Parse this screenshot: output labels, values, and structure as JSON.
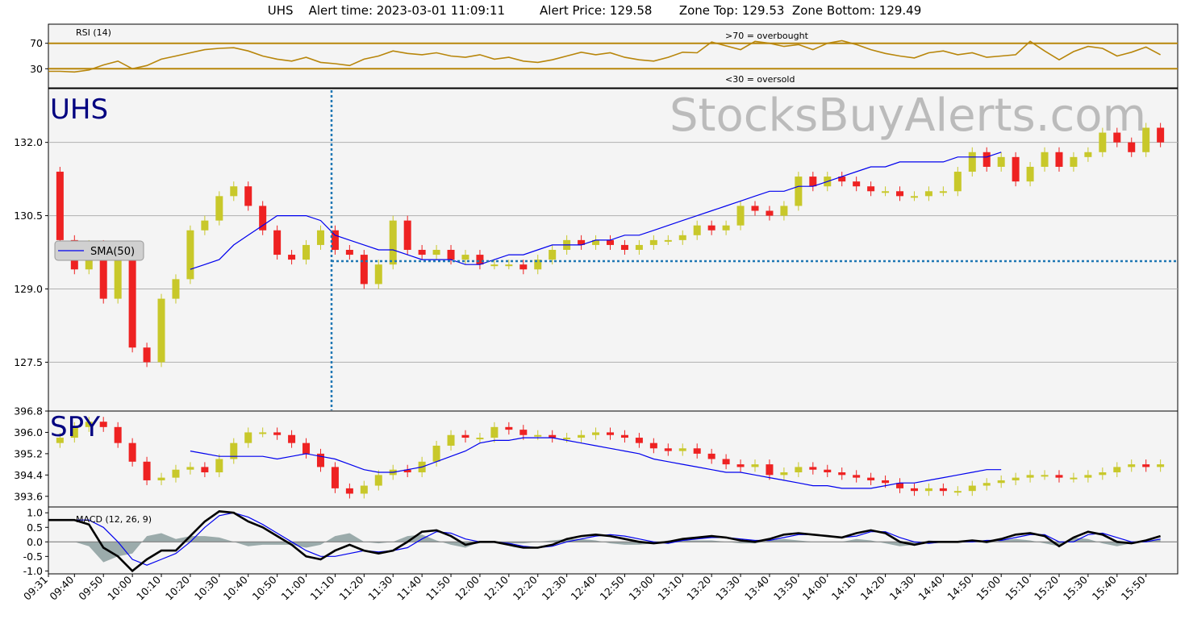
{
  "header": {
    "symbol": "UHS",
    "alert_time_label": "Alert time:",
    "alert_time": "2023-03-01 11:09:11",
    "alert_price_label": "Alert Price:",
    "alert_price": "129.58",
    "zone_top_label": "Zone Top:",
    "zone_top": "129.53",
    "zone_bottom_label": "Zone Bottom:",
    "zone_bottom": "129.49"
  },
  "watermark": "StocksBuyAlerts.com",
  "colors": {
    "panel_bg": "#f4f4f4",
    "rsi_line": "#b8860b",
    "candle_up": "#c8c82a",
    "candle_down": "#ee2222",
    "sma": "#0000ee",
    "volume": "#add8e6",
    "macd_line": "#000000",
    "signal_line": "#0000ee",
    "histogram": "#5f7a7a",
    "alert_marker": "#1f77b4",
    "symbol_label": "#000080",
    "watermark": "#bbbbbb"
  },
  "time_axis": {
    "labels": [
      "09:31",
      "09:40",
      "09:50",
      "10:00",
      "10:10",
      "10:20",
      "10:30",
      "10:40",
      "10:50",
      "11:00",
      "11:10",
      "11:20",
      "11:30",
      "11:40",
      "11:50",
      "12:00",
      "12:10",
      "12:20",
      "12:30",
      "12:40",
      "12:50",
      "13:00",
      "13:10",
      "13:20",
      "13:30",
      "13:40",
      "13:50",
      "14:00",
      "14:10",
      "14:20",
      "14:30",
      "14:40",
      "14:50",
      "15:00",
      "15:10",
      "15:20",
      "15:30",
      "15:40",
      "15:50"
    ]
  },
  "chart_data": [
    {
      "type": "line",
      "panel": "rsi",
      "title": "RSI (14)",
      "ylim": [
        0,
        100
      ],
      "yticks": [
        30,
        70
      ],
      "overbought_label": ">70 = overbought",
      "oversold_label": "<30 = oversold",
      "x": [
        "09:31",
        "09:35",
        "09:40",
        "09:45",
        "09:50",
        "09:55",
        "10:00",
        "10:05",
        "10:10",
        "10:15",
        "10:20",
        "10:25",
        "10:30",
        "10:35",
        "10:40",
        "10:45",
        "10:50",
        "10:55",
        "11:00",
        "11:05",
        "11:10",
        "11:15",
        "11:20",
        "11:25",
        "11:30",
        "11:35",
        "11:40",
        "11:45",
        "11:50",
        "11:55",
        "12:00",
        "12:05",
        "12:10",
        "12:15",
        "12:20",
        "12:25",
        "12:30",
        "12:35",
        "12:40",
        "12:45",
        "12:50",
        "12:55",
        "13:00",
        "13:05",
        "13:10",
        "13:15",
        "13:20",
        "13:25",
        "13:30",
        "13:35",
        "13:40",
        "13:45",
        "13:50",
        "13:55",
        "14:00",
        "14:05",
        "14:10",
        "14:15",
        "14:20",
        "14:25",
        "14:30",
        "14:35",
        "14:40",
        "14:45",
        "14:50",
        "14:55",
        "15:00",
        "15:05",
        "15:10",
        "15:15",
        "15:20",
        "15:25",
        "15:30",
        "15:35",
        "15:40",
        "15:45",
        "15:50",
        "15:55"
      ],
      "series": [
        {
          "values": [
            26,
            26,
            25,
            28,
            36,
            42,
            30,
            35,
            45,
            50,
            55,
            60,
            62,
            63,
            58,
            50,
            45,
            42,
            48,
            40,
            38,
            35,
            45,
            50,
            58,
            54,
            52,
            55,
            50,
            48,
            52,
            45,
            48,
            42,
            40,
            44,
            50,
            56,
            52,
            55,
            48,
            44,
            42,
            48,
            56,
            55,
            72,
            66,
            60,
            73,
            70,
            65,
            68,
            60,
            70,
            74,
            68,
            60,
            54,
            50,
            47,
            55,
            58,
            52,
            55,
            48,
            50,
            52,
            73,
            58,
            44,
            57,
            65,
            62,
            50,
            56,
            64,
            52
          ]
        }
      ]
    },
    {
      "type": "candlestick",
      "panel": "price",
      "title": "UHS",
      "ylim": [
        126.5,
        133.1
      ],
      "yticks": [
        127.5,
        129.0,
        130.5,
        132.0
      ],
      "legend": "SMA(50)",
      "x": [
        "09:31",
        "09:35",
        "09:40",
        "09:45",
        "09:50",
        "09:55",
        "10:00",
        "10:05",
        "10:10",
        "10:15",
        "10:20",
        "10:25",
        "10:30",
        "10:35",
        "10:40",
        "10:45",
        "10:50",
        "10:55",
        "11:00",
        "11:05",
        "11:10",
        "11:15",
        "11:20",
        "11:25",
        "11:30",
        "11:35",
        "11:40",
        "11:45",
        "11:50",
        "11:55",
        "12:00",
        "12:05",
        "12:10",
        "12:15",
        "12:20",
        "12:25",
        "12:30",
        "12:35",
        "12:40",
        "12:45",
        "12:50",
        "12:55",
        "13:00",
        "13:05",
        "13:10",
        "13:15",
        "13:20",
        "13:25",
        "13:30",
        "13:35",
        "13:40",
        "13:45",
        "13:50",
        "13:55",
        "14:00",
        "14:05",
        "14:10",
        "14:15",
        "14:20",
        "14:25",
        "14:30",
        "14:35",
        "14:40",
        "14:45",
        "14:50",
        "14:55",
        "15:00",
        "15:05",
        "15:10",
        "15:15",
        "15:20",
        "15:25",
        "15:30",
        "15:35",
        "15:40",
        "15:45",
        "15:50",
        "15:55"
      ],
      "close": [
        131.4,
        130.0,
        129.4,
        129.9,
        128.8,
        129.6,
        127.8,
        127.5,
        128.8,
        129.2,
        130.2,
        130.4,
        130.9,
        131.1,
        130.7,
        130.2,
        129.7,
        129.6,
        129.9,
        130.2,
        129.8,
        129.7,
        129.1,
        129.5,
        130.4,
        129.8,
        129.7,
        129.8,
        129.6,
        129.7,
        129.5,
        129.5,
        129.5,
        129.4,
        129.6,
        129.8,
        130.0,
        129.9,
        130.0,
        129.9,
        129.8,
        129.9,
        130.0,
        130.0,
        130.1,
        130.3,
        130.2,
        130.3,
        130.7,
        130.6,
        130.5,
        130.7,
        131.3,
        131.1,
        131.3,
        131.2,
        131.1,
        131.0,
        131.0,
        130.9,
        130.9,
        131.0,
        131.0,
        131.4,
        131.8,
        131.5,
        131.7,
        131.2,
        131.5,
        131.8,
        131.5,
        131.7,
        131.8,
        132.2,
        132.0,
        131.8,
        132.3,
        132.0
      ],
      "sma50": [
        null,
        null,
        null,
        null,
        null,
        null,
        null,
        null,
        null,
        null,
        129.4,
        129.5,
        129.6,
        129.9,
        130.1,
        130.3,
        130.5,
        130.5,
        130.5,
        130.4,
        130.1,
        130.0,
        129.9,
        129.8,
        129.8,
        129.7,
        129.6,
        129.6,
        129.6,
        129.5,
        129.5,
        129.6,
        129.7,
        129.7,
        129.8,
        129.9,
        129.9,
        129.9,
        130.0,
        130.0,
        130.1,
        130.1,
        130.2,
        130.3,
        130.4,
        130.5,
        130.6,
        130.7,
        130.8,
        130.9,
        131.0,
        131.0,
        131.1,
        131.1,
        131.2,
        131.3,
        131.4,
        131.5,
        131.5,
        131.6,
        131.6,
        131.6,
        131.6,
        131.7,
        131.7,
        131.7,
        131.8
      ]
    },
    {
      "type": "candlestick",
      "panel": "spy",
      "title": "SPY",
      "ylim": [
        393.2,
        396.8
      ],
      "yticks": [
        393.6,
        394.4,
        395.2,
        396.0,
        396.8
      ],
      "x": [
        "09:31",
        "09:35",
        "09:40",
        "09:45",
        "09:50",
        "09:55",
        "10:00",
        "10:05",
        "10:10",
        "10:15",
        "10:20",
        "10:25",
        "10:30",
        "10:35",
        "10:40",
        "10:45",
        "10:50",
        "10:55",
        "11:00",
        "11:05",
        "11:10",
        "11:15",
        "11:20",
        "11:25",
        "11:30",
        "11:35",
        "11:40",
        "11:45",
        "11:50",
        "11:55",
        "12:00",
        "12:05",
        "12:10",
        "12:15",
        "12:20",
        "12:25",
        "12:30",
        "12:35",
        "12:40",
        "12:45",
        "12:50",
        "12:55",
        "13:00",
        "13:05",
        "13:10",
        "13:15",
        "13:20",
        "13:25",
        "13:30",
        "13:35",
        "13:40",
        "13:45",
        "13:50",
        "13:55",
        "14:00",
        "14:05",
        "14:10",
        "14:15",
        "14:20",
        "14:25",
        "14:30",
        "14:35",
        "14:40",
        "14:45",
        "14:50",
        "14:55",
        "15:00",
        "15:05",
        "15:10",
        "15:15",
        "15:20",
        "15:25",
        "15:30",
        "15:35",
        "15:40",
        "15:45",
        "15:50",
        "15:55"
      ],
      "close": [
        395.6,
        395.8,
        396.2,
        396.4,
        396.2,
        395.6,
        394.9,
        394.2,
        394.3,
        394.6,
        394.7,
        394.5,
        395.0,
        395.6,
        396.0,
        396.0,
        395.9,
        395.6,
        395.2,
        394.7,
        393.9,
        393.7,
        394.0,
        394.4,
        394.6,
        394.5,
        394.9,
        395.5,
        395.9,
        395.8,
        395.8,
        396.2,
        396.1,
        395.9,
        395.9,
        395.8,
        395.8,
        395.9,
        396.0,
        395.9,
        395.8,
        395.6,
        395.4,
        395.3,
        395.4,
        395.2,
        395.0,
        394.8,
        394.7,
        394.8,
        394.4,
        394.5,
        394.7,
        394.6,
        394.5,
        394.4,
        394.3,
        394.2,
        394.1,
        393.9,
        393.8,
        393.9,
        393.8,
        393.8,
        394.0,
        394.1,
        394.2,
        394.3,
        394.4,
        394.4,
        394.3,
        394.3,
        394.4,
        394.5,
        394.7,
        394.8,
        394.7,
        394.8
      ],
      "sma50": [
        null,
        null,
        null,
        null,
        null,
        null,
        null,
        null,
        null,
        null,
        395.3,
        395.2,
        395.1,
        395.1,
        395.1,
        395.1,
        395.0,
        395.1,
        395.2,
        395.1,
        395.0,
        394.8,
        394.6,
        394.5,
        394.5,
        394.6,
        394.7,
        394.9,
        395.1,
        395.3,
        395.6,
        395.7,
        395.7,
        395.8,
        395.8,
        395.8,
        395.7,
        395.6,
        395.5,
        395.4,
        395.3,
        395.2,
        395.0,
        394.9,
        394.8,
        394.7,
        394.6,
        394.5,
        394.5,
        394.4,
        394.3,
        394.2,
        394.1,
        394.0,
        394.0,
        393.9,
        393.9,
        393.9,
        394.0,
        394.1,
        394.1,
        394.2,
        394.3,
        394.4,
        394.5,
        394.6,
        394.6
      ]
    },
    {
      "type": "line",
      "panel": "macd",
      "title": "MACD (12, 26, 9)",
      "ylim": [
        -1.1,
        1.2
      ],
      "yticks": [
        -1.0,
        -0.5,
        0.0,
        0.5,
        1.0
      ],
      "x": [
        "09:31",
        "09:35",
        "09:40",
        "09:45",
        "09:50",
        "09:55",
        "10:00",
        "10:05",
        "10:10",
        "10:15",
        "10:20",
        "10:25",
        "10:30",
        "10:35",
        "10:40",
        "10:45",
        "10:50",
        "10:55",
        "11:00",
        "11:05",
        "11:10",
        "11:15",
        "11:20",
        "11:25",
        "11:30",
        "11:35",
        "11:40",
        "11:45",
        "11:50",
        "11:55",
        "12:00",
        "12:05",
        "12:10",
        "12:15",
        "12:20",
        "12:25",
        "12:30",
        "12:35",
        "12:40",
        "12:45",
        "12:50",
        "12:55",
        "13:00",
        "13:05",
        "13:10",
        "13:15",
        "13:20",
        "13:25",
        "13:30",
        "13:35",
        "13:40",
        "13:45",
        "13:50",
        "13:55",
        "14:00",
        "14:05",
        "14:10",
        "14:15",
        "14:20",
        "14:25",
        "14:30",
        "14:35",
        "14:40",
        "14:45",
        "14:50",
        "14:55",
        "15:00",
        "15:05",
        "15:10",
        "15:15",
        "15:20",
        "15:25",
        "15:30",
        "15:35",
        "15:40",
        "15:45",
        "15:50",
        "15:55"
      ],
      "series": [
        {
          "name": "MACD",
          "values": [
            0.75,
            0.75,
            0.75,
            0.6,
            -0.2,
            -0.5,
            -1.0,
            -0.6,
            -0.3,
            -0.3,
            0.2,
            0.7,
            1.05,
            1.0,
            0.7,
            0.5,
            0.2,
            -0.1,
            -0.5,
            -0.6,
            -0.3,
            -0.1,
            -0.3,
            -0.4,
            -0.3,
            0.0,
            0.35,
            0.4,
            0.2,
            -0.1,
            0.0,
            0.0,
            -0.1,
            -0.2,
            -0.2,
            -0.1,
            0.1,
            0.2,
            0.25,
            0.2,
            0.1,
            0.0,
            -0.05,
            0.0,
            0.1,
            0.15,
            0.2,
            0.15,
            0.05,
            0.0,
            0.1,
            0.25,
            0.3,
            0.25,
            0.2,
            0.15,
            0.3,
            0.4,
            0.3,
            0.0,
            -0.1,
            0.0,
            0.0,
            0.0,
            0.05,
            0.0,
            0.1,
            0.25,
            0.3,
            0.2,
            -0.15,
            0.15,
            0.35,
            0.25,
            0.0,
            -0.05,
            0.05,
            0.2
          ]
        },
        {
          "name": "Signal",
          "values": [
            0.75,
            0.75,
            0.75,
            0.75,
            0.5,
            0.0,
            -0.6,
            -0.8,
            -0.6,
            -0.4,
            0.0,
            0.5,
            0.9,
            1.0,
            0.85,
            0.6,
            0.3,
            0.0,
            -0.3,
            -0.5,
            -0.5,
            -0.4,
            -0.3,
            -0.35,
            -0.3,
            -0.2,
            0.1,
            0.35,
            0.3,
            0.1,
            0.0,
            0.0,
            -0.05,
            -0.15,
            -0.2,
            -0.15,
            0.0,
            0.1,
            0.2,
            0.25,
            0.2,
            0.1,
            0.0,
            -0.05,
            0.05,
            0.1,
            0.15,
            0.15,
            0.1,
            0.05,
            0.05,
            0.15,
            0.25,
            0.25,
            0.2,
            0.15,
            0.2,
            0.35,
            0.35,
            0.15,
            0.0,
            -0.05,
            0.0,
            0.0,
            0.0,
            0.05,
            0.05,
            0.15,
            0.25,
            0.25,
            0.0,
            0.0,
            0.25,
            0.3,
            0.15,
            0.0,
            0.0,
            0.1
          ]
        }
      ]
    }
  ]
}
